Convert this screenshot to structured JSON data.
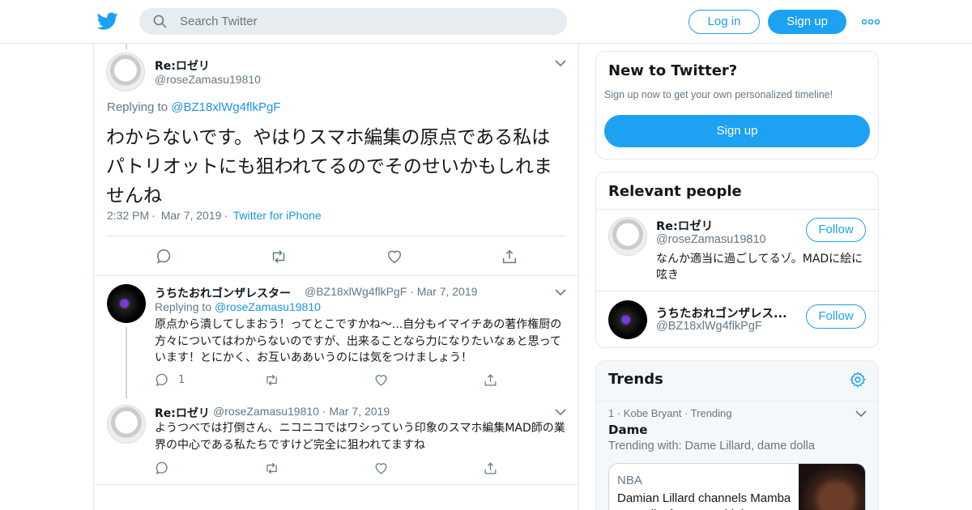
{
  "header": {
    "search_placeholder": "Search Twitter",
    "login_label": "Log in",
    "signup_label": "Sign up",
    "accent": "#1da1f2"
  },
  "main_tweet": {
    "name": "Re:ロゼリ",
    "handle": "@roseZamasu19810",
    "replying_prefix": "Replying to",
    "replying_to": "@BZ18xlWg4flkPgF",
    "text": "わからないです。やはりスマホ編集の原点である私はパトリオットにも狙われてるのでそのせいかもしれませんね",
    "time": "2:32 PM",
    "date": "Mar 7, 2019",
    "source": "Twitter for iPhone"
  },
  "replies": [
    {
      "name": "うちたおれゴンザレスター",
      "handle": "@BZ18xlWg4flkPgF",
      "date": "Mar 7, 2019",
      "replying_prefix": "Replying to",
      "replying_to": "@roseZamasu19810",
      "text": "原点から潰してしまおう！ってとこですかね〜...自分もイマイチあの著作権厨の方々についてはわからないのですが、出来ることなら力になりたいなぁと思っています！とにかく、お互いああいうのには気をつけましょう！",
      "reply_count": "1"
    },
    {
      "name": "Re:ロゼリ",
      "handle": "@roseZamasu19810",
      "date": "Mar 7, 2019",
      "text": "ようつべでは打倒さん、ニコニコではワシっていう印象のスマホ編集MAD師の業界の中心である私たちですけど完全に狙われてますね"
    }
  ],
  "new_to_twitter": {
    "title": "New to Twitter?",
    "description": "Sign up now to get your own personalized timeline!",
    "signup_label": "Sign up"
  },
  "relevant_people": {
    "title": "Relevant people",
    "people": [
      {
        "name": "Re:ロゼリ",
        "handle": "@roseZamasu19810",
        "bio": "なんか適当に過ごしてるゾ。MADに絵に呟き",
        "follow_label": "Follow"
      },
      {
        "name": "うちたおれゴンザレス...",
        "handle": "@BZ18xlWg4flkPgF",
        "follow_label": "Follow"
      }
    ]
  },
  "trends": {
    "title": "Trends",
    "items": [
      {
        "rank": "1",
        "context": "Kobe Bryant",
        "status": "Trending",
        "name": "Dame",
        "trending_with": "Trending with: Dame Lillard, dame dolla",
        "news": {
          "source": "NBA",
          "headline": "Damian Lillard channels Mamba Mentality for career high"
        }
      }
    ]
  }
}
